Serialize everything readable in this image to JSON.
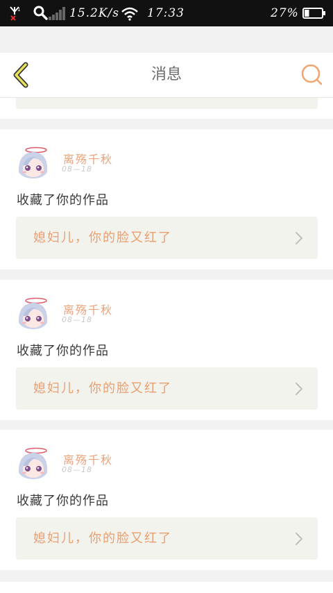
{
  "status_bar": {
    "speed": "15.2K/s",
    "time": "17:33",
    "battery": "27%",
    "battery_level": 0.27,
    "icons": [
      "no-signal-icon",
      "search-icon",
      "signal-bars-icon",
      "wifi-icon",
      "battery-icon"
    ]
  },
  "header": {
    "title": "消息",
    "back_icon": "chevron-left-icon",
    "search_icon": "search-icon"
  },
  "colors": {
    "accent_orange": "#eb9e6f",
    "back_yellow": "#e9e15a",
    "card_bg": "#f3f3ee"
  },
  "messages": [
    {
      "user": "离殇千秋",
      "date": "08—18",
      "action": "收藏了你的作品",
      "work": "媳妇儿，你的脸又红了"
    },
    {
      "user": "离殇千秋",
      "date": "08—18",
      "action": "收藏了你的作品",
      "work": "媳妇儿，你的脸又红了"
    },
    {
      "user": "离殇千秋",
      "date": "08—18",
      "action": "收藏了你的作品",
      "work": "媳妇儿，你的脸又红了"
    }
  ]
}
